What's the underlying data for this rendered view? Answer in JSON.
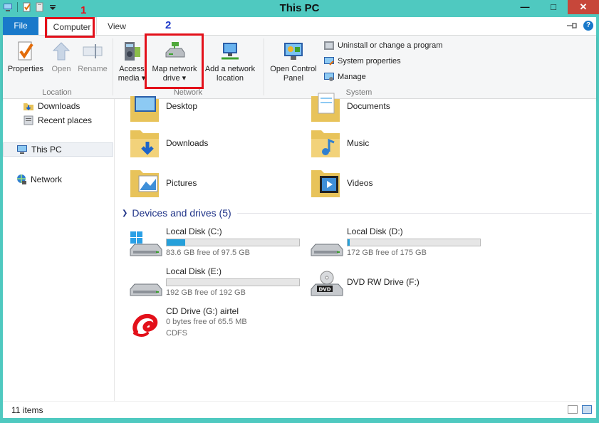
{
  "window": {
    "title": "This PC"
  },
  "tabs": {
    "file": "File",
    "computer": "Computer",
    "view": "View"
  },
  "ribbon": {
    "location": {
      "label": "Location",
      "properties": "Properties",
      "open": "Open",
      "rename": "Rename"
    },
    "network": {
      "label": "Network",
      "access_media_1": "Access",
      "access_media_2": "media",
      "map_drive_1": "Map network",
      "map_drive_2": "drive",
      "add_location_1": "Add a network",
      "add_location_2": "location"
    },
    "system": {
      "label": "System",
      "control_panel_1": "Open Control",
      "control_panel_2": "Panel",
      "uninstall": "Uninstall or change a program",
      "system_properties": "System properties",
      "manage": "Manage"
    }
  },
  "annotations": {
    "step1": "1",
    "step2": "2",
    "color": "#e3101a",
    "step1_color": "#e3101a",
    "step2_color": "#1a36c8"
  },
  "nav": {
    "downloads": "Downloads",
    "recent": "Recent places",
    "this_pc": "This PC",
    "network": "Network"
  },
  "folders": [
    {
      "name": "Desktop",
      "icon": "desktop-folder-icon"
    },
    {
      "name": "Documents",
      "icon": "documents-folder-icon"
    },
    {
      "name": "Downloads",
      "icon": "downloads-folder-icon"
    },
    {
      "name": "Music",
      "icon": "music-folder-icon"
    },
    {
      "name": "Pictures",
      "icon": "pictures-folder-icon"
    },
    {
      "name": "Videos",
      "icon": "videos-folder-icon"
    }
  ],
  "devices": {
    "header": "Devices and drives (5)",
    "drives": [
      {
        "name": "Local Disk (C:)",
        "free": "83.6 GB free of 97.5 GB",
        "used_fraction": 0.14
      },
      {
        "name": "Local Disk (D:)",
        "free": "172 GB free of 175 GB",
        "used_fraction": 0.02
      },
      {
        "name": "Local Disk (E:)",
        "free": "192 GB free of 192 GB",
        "used_fraction": 0.0
      },
      {
        "name": "DVD RW Drive (F:)"
      },
      {
        "name": "CD Drive (G:) airtel",
        "free": "0 bytes free of 65.5 MB",
        "fs": "CDFS"
      }
    ]
  },
  "status": {
    "items": "11 items"
  },
  "colors": {
    "accent": "#1979ca",
    "frame": "#4fc9c0",
    "bar_fill": "#26a0da"
  }
}
